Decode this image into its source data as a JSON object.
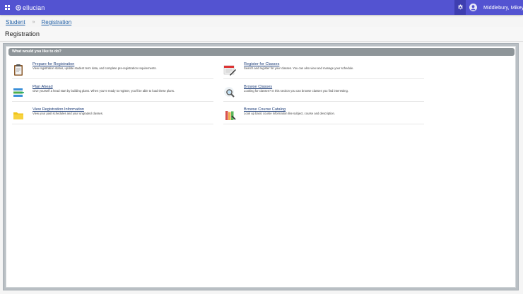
{
  "header": {
    "brand": "ellucian",
    "user_name": "Middlebury, Mikey"
  },
  "breadcrumb": {
    "items": [
      "Student",
      "Registration"
    ],
    "separator": "»"
  },
  "page": {
    "title": "Registration"
  },
  "panel": {
    "header": "What would you like to do?",
    "items": [
      {
        "title": "Prepare for Registration",
        "description": "View registration status, update student term data, and complete pre-registration requirements.",
        "icon": "clipboard-icon"
      },
      {
        "title": "Register for Classes",
        "description": "Search and register for your classes. You can also view and manage your schedule.",
        "icon": "calendar-pencil-icon"
      },
      {
        "title": "Plan Ahead",
        "description": "Give yourself a head start by building plans. When you're ready to register, you'll be able to load these plans.",
        "icon": "plan-list-icon"
      },
      {
        "title": "Browse Classes",
        "description": "Looking for classes? In this section you can browse classes you find interesting.",
        "icon": "magnifier-icon"
      },
      {
        "title": "View Registration Information",
        "description": "View your past schedules and your ungraded classes.",
        "icon": "folder-icon"
      },
      {
        "title": "Browse Course Catalog",
        "description": "Look up basic course information like subject, course and description.",
        "icon": "books-icon"
      }
    ]
  },
  "colors": {
    "topbar": "#5353d1",
    "link": "#1f5fa6",
    "panel_header": "#8e9599"
  }
}
